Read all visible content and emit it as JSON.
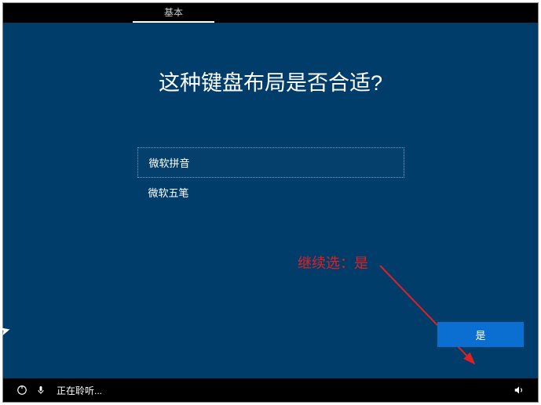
{
  "tab": {
    "label": "基本"
  },
  "title": "这种键盘布局是否合适?",
  "options": [
    {
      "label": "微软拼音",
      "selected": true
    },
    {
      "label": "微软五笔",
      "selected": false
    }
  ],
  "annotation": "继续选：是",
  "buttons": {
    "yes": "是"
  },
  "taskbar": {
    "listening": "正在聆听..."
  }
}
